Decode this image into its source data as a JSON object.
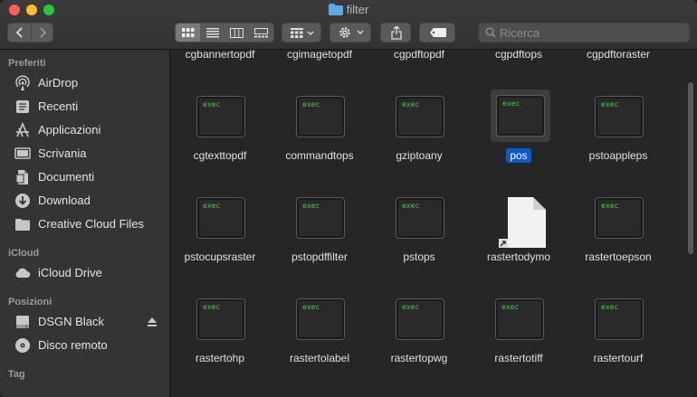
{
  "window": {
    "title": "filter"
  },
  "toolbar": {
    "search_placeholder": "Ricerca"
  },
  "sidebar": {
    "sections": [
      {
        "label": "Preferiti"
      },
      {
        "label": "iCloud"
      },
      {
        "label": "Posizioni"
      },
      {
        "label": "Tag"
      }
    ],
    "favorites": [
      {
        "label": "AirDrop",
        "icon": "airdrop-icon"
      },
      {
        "label": "Recenti",
        "icon": "clock-icon"
      },
      {
        "label": "Applicazioni",
        "icon": "applications-icon"
      },
      {
        "label": "Scrivania",
        "icon": "desktop-icon"
      },
      {
        "label": "Documenti",
        "icon": "document-icon"
      },
      {
        "label": "Download",
        "icon": "download-icon"
      },
      {
        "label": "Creative Cloud Files",
        "icon": "folder-icon"
      }
    ],
    "icloud": [
      {
        "label": "iCloud Drive",
        "icon": "cloud-icon"
      }
    ],
    "locations": [
      {
        "label": "DSGN Black",
        "icon": "drive-icon"
      },
      {
        "label": "Disco remoto",
        "icon": "disc-icon"
      }
    ]
  },
  "files": [
    {
      "name": "cgbannertopdf",
      "kind": "exec"
    },
    {
      "name": "cgimagetopdf",
      "kind": "exec"
    },
    {
      "name": "cgpdftopdf",
      "kind": "exec"
    },
    {
      "name": "cgpdftops",
      "kind": "exec"
    },
    {
      "name": "cgpdftoraster",
      "kind": "exec"
    },
    {
      "name": "cgtexttopdf",
      "kind": "exec"
    },
    {
      "name": "commandtops",
      "kind": "exec"
    },
    {
      "name": "gziptoany",
      "kind": "exec"
    },
    {
      "name": "pos",
      "kind": "exec",
      "selected": true
    },
    {
      "name": "pstoappleps",
      "kind": "exec"
    },
    {
      "name": "pstocupsraster",
      "kind": "exec"
    },
    {
      "name": "pstopdffilter",
      "kind": "exec"
    },
    {
      "name": "pstops",
      "kind": "exec"
    },
    {
      "name": "rastertodymo",
      "kind": "document"
    },
    {
      "name": "rastertoepson",
      "kind": "exec"
    },
    {
      "name": "rastertohp",
      "kind": "exec"
    },
    {
      "name": "rastertolabel",
      "kind": "exec"
    },
    {
      "name": "rastertopwg",
      "kind": "exec"
    },
    {
      "name": "rastertotiff",
      "kind": "exec"
    },
    {
      "name": "rastertourf",
      "kind": "exec"
    }
  ],
  "exec_label": "exec",
  "colors": {
    "selection": "#1058d0",
    "exec_text": "#4dc94d"
  }
}
